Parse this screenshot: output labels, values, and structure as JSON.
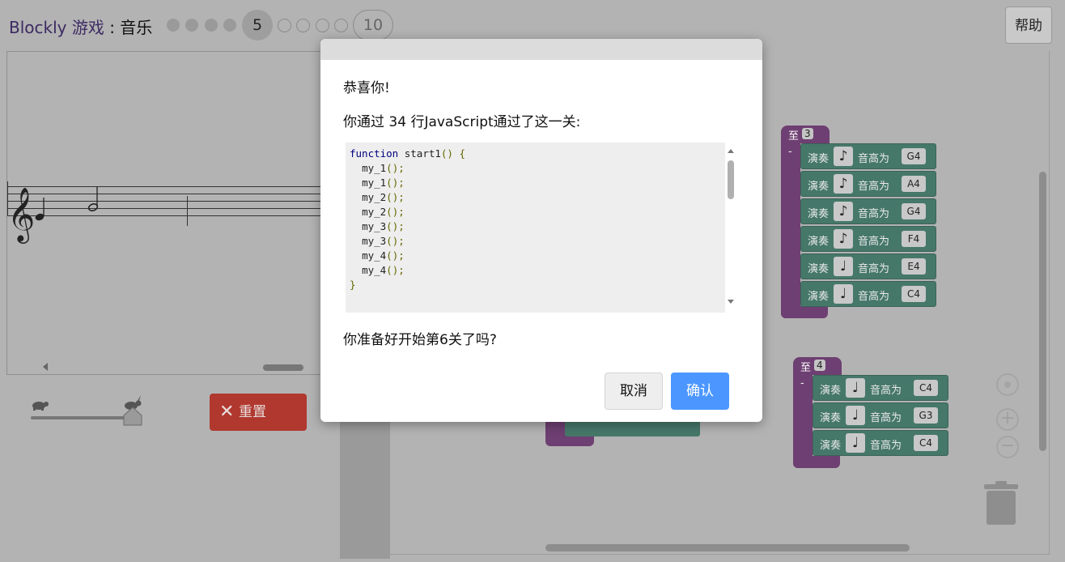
{
  "header": {
    "brand": "Blockly 游戏",
    "separator": " : ",
    "game": "音乐",
    "current_level": "5",
    "last_level": "10",
    "help_label": "帮助"
  },
  "controls": {
    "reset_label": "重置",
    "slow_icon": "turtle-icon",
    "fast_icon": "rabbit-icon"
  },
  "workspace": {
    "func3_label": "至",
    "func3_num": "3",
    "func4_label": "至",
    "func4_num": "4",
    "play_label": "演奏",
    "pitch_label": "音高为",
    "func3_rows": [
      {
        "note": "♪",
        "pitch": "G4"
      },
      {
        "note": "♪",
        "pitch": "A4"
      },
      {
        "note": "♪",
        "pitch": "G4"
      },
      {
        "note": "♪",
        "pitch": "F4"
      },
      {
        "note": "♩",
        "pitch": "E4"
      },
      {
        "note": "♩",
        "pitch": "C4"
      }
    ],
    "func4_rows": [
      {
        "note": "♩",
        "pitch": "C4"
      },
      {
        "note": "♩",
        "pitch": "G3"
      },
      {
        "note": "♩",
        "pitch": "C4"
      }
    ]
  },
  "dialog": {
    "congrats": "恭喜你!",
    "lines_message": "你通过 34 行JavaScript通过了这一关:",
    "code": {
      "kw": "function",
      "fname": " start1",
      "sig_rest": "() {",
      "calls": [
        "my_1",
        "my_1",
        "my_2",
        "my_2",
        "my_3",
        "my_3",
        "my_4",
        "my_4"
      ],
      "call_suffix": "();",
      "close": "}"
    },
    "ready_message": "你准备好开始第6关了吗?",
    "cancel_label": "取消",
    "ok_label": "确认"
  }
}
